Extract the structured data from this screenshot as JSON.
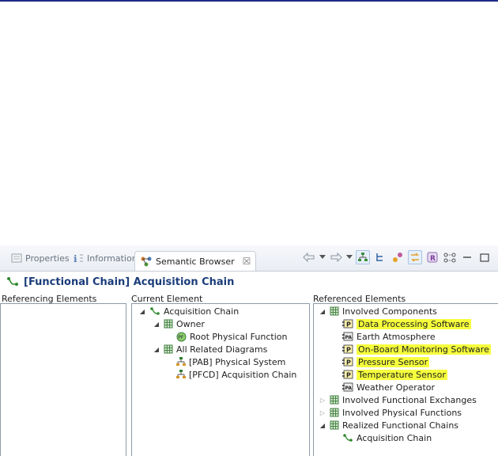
{
  "tabs": [
    {
      "label": "Properties"
    },
    {
      "label": "Information"
    },
    {
      "label": "Semantic Browser",
      "close": "☒"
    }
  ],
  "toolbar": {
    "icons": [
      "back-arrow-icon",
      "dropdown-icon",
      "forward-arrow-icon",
      "dropdown-icon",
      "diagram-icon",
      "hierarchy-icon",
      "link-icon",
      "sync-icon",
      "r-icon",
      "view-menu-icon",
      "minimize-icon",
      "maximize-icon"
    ]
  },
  "header": {
    "title": "[Functional Chain] Acquisition Chain"
  },
  "columns": {
    "referencing": "Referencing Elements",
    "current": "Current Element",
    "referenced": "Referenced Elements"
  },
  "current_tree": [
    {
      "label": "Acquisition Chain",
      "expanded": true
    },
    {
      "label": "Owner",
      "expanded": true
    },
    {
      "label": "Root Physical Function"
    },
    {
      "label": "All Related Diagrams",
      "expanded": true
    },
    {
      "label": "[PAB] Physical System"
    },
    {
      "label": "[PFCD] Acquisition Chain"
    }
  ],
  "referenced_tree": [
    {
      "label": "Involved Components",
      "expanded": true
    },
    {
      "label": "Data Processing Software",
      "highlight": true
    },
    {
      "label": "Earth Atmosphere"
    },
    {
      "label": "On-Board Monitoring Software",
      "highlight": true
    },
    {
      "label": "Pressure Sensor",
      "highlight": true
    },
    {
      "label": "Temperature Sensor",
      "highlight": true
    },
    {
      "label": "Weather Operator"
    },
    {
      "label": "Involved Functional Exchanges",
      "expanded": false
    },
    {
      "label": "Involved Physical Functions",
      "expanded": false
    },
    {
      "label": "Realized Functional Chains",
      "expanded": true
    },
    {
      "label": "Acquisition Chain"
    }
  ],
  "colors": {
    "highlight": "#f6ff3c",
    "title": "#1b3d7a"
  }
}
